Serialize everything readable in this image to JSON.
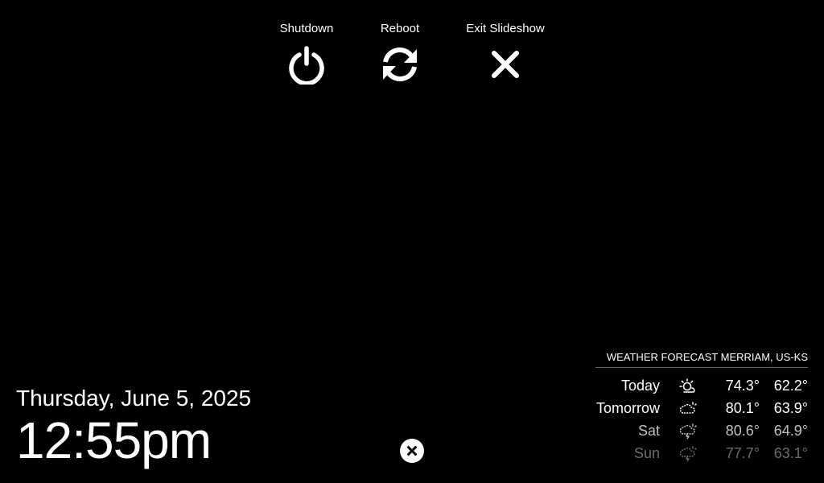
{
  "controls": {
    "shutdown": {
      "label": "Shutdown",
      "icon": "power-icon"
    },
    "reboot": {
      "label": "Reboot",
      "icon": "refresh-icon"
    },
    "exit": {
      "label": "Exit Slideshow",
      "icon": "close-icon"
    }
  },
  "clock": {
    "date": "Thursday, June 5, 2025",
    "time": "12:55pm"
  },
  "small_close": {
    "icon": "close-icon"
  },
  "weather": {
    "header": "WEATHER FORECAST MERRIAM, US-KS",
    "rows": [
      {
        "day": "Today",
        "icon": "partly-sunny-icon",
        "high": "74.3°",
        "low": "62.2°"
      },
      {
        "day": "Tomorrow",
        "icon": "cloudy-sun-icon",
        "high": "80.1°",
        "low": "63.9°"
      },
      {
        "day": "Sat",
        "icon": "storm-icon",
        "high": "80.6°",
        "low": "64.9°"
      },
      {
        "day": "Sun",
        "icon": "storm-icon",
        "high": "77.7°",
        "low": "63.1°"
      }
    ]
  }
}
